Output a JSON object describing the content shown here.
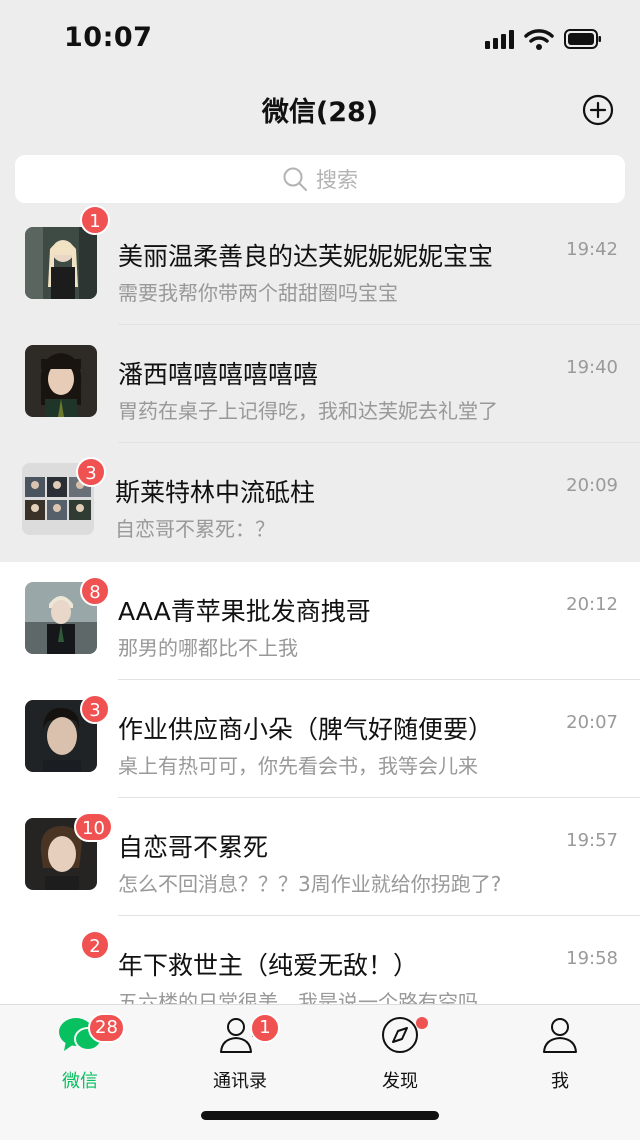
{
  "status_bar": {
    "time": "10:07"
  },
  "header": {
    "title": "微信(28)"
  },
  "search": {
    "placeholder": "搜索"
  },
  "chats": [
    {
      "name": "美丽温柔善良的达芙妮妮妮妮宝宝",
      "message": "需要我帮你带两个甜甜圈吗宝宝",
      "time": "19:42",
      "badge": "1",
      "pinned": true
    },
    {
      "name": "潘西嘻嘻嘻嘻嘻嘻",
      "message": "胃药在桌子上记得吃，我和达芙妮去礼堂了",
      "time": "19:40",
      "badge": "",
      "pinned": true
    },
    {
      "name": "斯莱特林中流砥柱",
      "message": "自恋哥不累死：？",
      "time": "20:09",
      "badge": "3",
      "pinned": true
    },
    {
      "name": "AAA青苹果批发商拽哥",
      "message": "那男的哪都比不上我",
      "time": "20:12",
      "badge": "8",
      "pinned": false
    },
    {
      "name": "作业供应商小朵（脾气好随便要）",
      "message": "桌上有热可可，你先看会书，我等会儿来",
      "time": "20:07",
      "badge": "3",
      "pinned": false
    },
    {
      "name": "自恋哥不累死",
      "message": "怎么不回消息？？？3周作业就给你拐跑了?",
      "time": "19:57",
      "badge": "10",
      "pinned": false
    },
    {
      "name": "年下救世主（纯爱无敌！）",
      "message": "五六楼的日常很美，我是说一个路有空吗",
      "time": "19:58",
      "badge": "2",
      "pinned": false
    }
  ],
  "tabbar": {
    "items": [
      {
        "label": "微信",
        "icon": "chat-bubbles-icon",
        "badge": "28",
        "active": true
      },
      {
        "label": "通讯录",
        "icon": "contacts-icon",
        "badge": "1",
        "active": false
      },
      {
        "label": "发现",
        "icon": "compass-icon",
        "badge": "",
        "active": false
      },
      {
        "label": "我",
        "icon": "person-icon",
        "badge": "",
        "active": false
      }
    ]
  },
  "colors": {
    "accent": "#07c160",
    "badge": "#f05252",
    "pinned_bg": "#ededed"
  }
}
